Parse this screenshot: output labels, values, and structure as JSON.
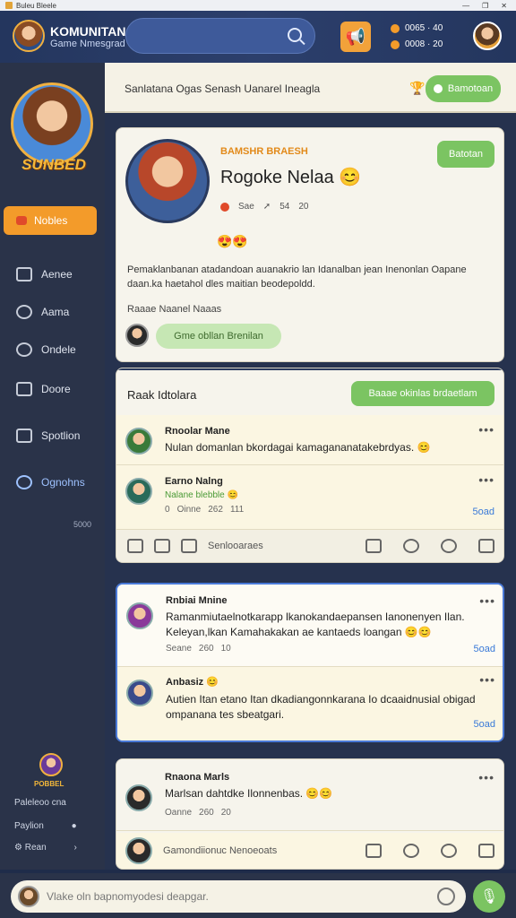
{
  "titlebar": {
    "title": "Buleu Bleele",
    "controls": [
      "—",
      "❐",
      "✕"
    ]
  },
  "header": {
    "brand_title": "KOMUNITAN",
    "brand_subtitle": "Game Nmesgrad",
    "search_icon": "search-icon",
    "megaphone_icon": "megaphone-icon",
    "stats": [
      "0065 · 40",
      "0008 · 20"
    ]
  },
  "sidebar": {
    "brand": "SUNBED",
    "active_item": "Nobles",
    "items": [
      {
        "label": "Aenee",
        "icon": "home-icon"
      },
      {
        "label": "Aama",
        "icon": "user-icon"
      },
      {
        "label": "Ondele",
        "icon": "search-icon"
      },
      {
        "label": "Doore",
        "icon": "shield-icon"
      },
      {
        "label": "Spotlion",
        "icon": "flag-icon"
      },
      {
        "label": "Ognohns",
        "icon": "settings-icon"
      }
    ],
    "small_text": "5000",
    "bottom_label": "POBBEL",
    "foot_items": [
      "Paleleoo cna",
      "Paylion",
      "Rean"
    ]
  },
  "topbar": {
    "text": "Sanlatana Ogas Senash Uanarel Ineagla",
    "button_label": "Bamotoan"
  },
  "profile": {
    "tag": "BAMSHR BRAESH",
    "name": "Rogoke Nelaa",
    "name_emoji": "😊",
    "stats": [
      "Sae",
      "54",
      "20"
    ],
    "follow_label": "Batotan",
    "emoji": "😍😍",
    "bio": "Pemaklanbanan atadandoan auanakrio lan Idanalban jean Inenonlan Oapane daan.ka haetahol dles maitian beodepoldd.",
    "meta": "Raaae Naanel Naaas",
    "cta_label": "Gme obllan Brenilan"
  },
  "feed": {
    "title": "Raak Idtolara",
    "button_label": "Baaae okinlas brdaetlam",
    "posts": [
      {
        "author": "Rnoolar Mane",
        "text": "Nulan domanlan bkordagai kamagananatakebrdyas. 😊"
      },
      {
        "author": "Earno Nalng",
        "sub": "Nalane blebble 😊",
        "meta": [
          "0",
          "Oinne",
          "262",
          "111"
        ],
        "share": "5oad"
      }
    ],
    "action_label": "Senlooaraes"
  },
  "feed2": {
    "posts": [
      {
        "author": "Rnbiai Mnine",
        "text": "Ramanmiutaelnotkarapp lkanokandaepansen Ianonenyen Ilan. Keleyan,lkan Kamahakakan ae kantaeds loangan 😊😊",
        "meta": [
          "Seane",
          "260",
          "10"
        ],
        "share": "5oad"
      },
      {
        "author": "Anbasiz 😊",
        "text": "Autien Itan etano Itan dkadiangonnkarana Io dcaaidnusial obigad ompanana tes sbeatgari.",
        "share": "5oad"
      }
    ]
  },
  "feed3": {
    "post": {
      "author": "Rnaona Marls",
      "text": "Marlsan dahtdke Ilonnenbas. 😊😊",
      "meta": [
        "Oanne",
        "260",
        "20"
      ]
    },
    "composer_label": "Gamondiionuc Nenoeoats"
  },
  "composer": {
    "placeholder": "Vlake oln bapnomyodesi deapgar.",
    "mic_icon": "mic-icon"
  }
}
